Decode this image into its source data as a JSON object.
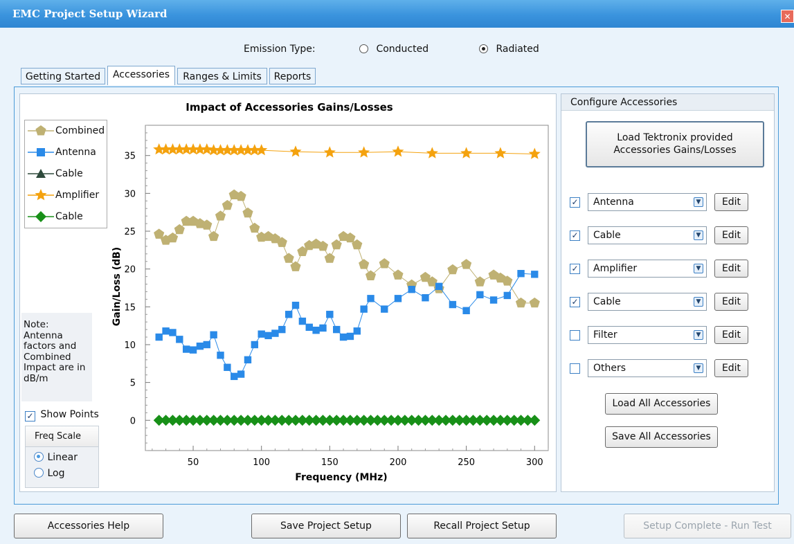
{
  "window": {
    "title": "EMC Project Setup Wizard",
    "close_icon": "close-icon"
  },
  "emission": {
    "label": "Emission Type:",
    "options": [
      {
        "label": "Conducted",
        "selected": false
      },
      {
        "label": "Radiated",
        "selected": true
      }
    ]
  },
  "tabs": [
    {
      "label": "Getting Started",
      "active": false
    },
    {
      "label": "Accessories",
      "active": true
    },
    {
      "label": "Ranges & Limits",
      "active": false
    },
    {
      "label": "Reports",
      "active": false
    }
  ],
  "chart_panel": {
    "note": "Note:\nAntenna\nfactors and\nCombined\nImpact are in\ndB/m",
    "show_points": {
      "label": "Show Points",
      "checked": true
    },
    "freq_scale": {
      "title": "Freq Scale",
      "options": [
        {
          "label": "Linear",
          "selected": true
        },
        {
          "label": "Log",
          "selected": false
        }
      ]
    }
  },
  "chart_data": {
    "type": "line",
    "title": "Impact of Accessories Gains/Losses",
    "xlabel": "Frequency (MHz)",
    "ylabel": "Gain/Loss (dB)",
    "xlim": [
      15,
      310
    ],
    "ylim": [
      -4,
      39
    ],
    "xticks": [
      50,
      100,
      150,
      200,
      250,
      300
    ],
    "yticks": [
      0,
      5,
      10,
      15,
      20,
      25,
      30,
      35
    ],
    "legend_position": "top-left",
    "series": [
      {
        "name": "Combined",
        "color": "#bfb173",
        "marker": "pentagon",
        "x": [
          25,
          30,
          35,
          40,
          45,
          50,
          55,
          60,
          65,
          70,
          75,
          80,
          85,
          90,
          95,
          100,
          105,
          110,
          115,
          120,
          125,
          130,
          135,
          140,
          145,
          150,
          155,
          160,
          165,
          170,
          175,
          180,
          190,
          200,
          210,
          220,
          225,
          230,
          240,
          250,
          260,
          270,
          275,
          280,
          290,
          300
        ],
        "y": [
          24.6,
          23.8,
          24.1,
          25.2,
          26.3,
          26.3,
          26.0,
          25.8,
          24.3,
          27.0,
          28.4,
          29.8,
          29.6,
          27.4,
          25.4,
          24.2,
          24.3,
          24.0,
          23.5,
          21.4,
          20.3,
          22.3,
          23.1,
          23.3,
          23.0,
          21.4,
          23.2,
          24.3,
          24.1,
          23.2,
          20.6,
          19.1,
          20.7,
          19.2,
          17.9,
          18.9,
          18.3,
          17.4,
          19.9,
          20.6,
          18.3,
          19.2,
          18.8,
          18.4,
          15.5,
          15.5
        ]
      },
      {
        "name": "Antenna",
        "color": "#2a8ae8",
        "marker": "square",
        "x": [
          25,
          30,
          35,
          40,
          45,
          50,
          55,
          60,
          65,
          70,
          75,
          80,
          85,
          90,
          95,
          100,
          105,
          110,
          115,
          120,
          125,
          130,
          135,
          140,
          145,
          150,
          155,
          160,
          165,
          170,
          175,
          180,
          190,
          200,
          210,
          220,
          230,
          240,
          250,
          260,
          270,
          280,
          290,
          300
        ],
        "y": [
          11.0,
          11.8,
          11.6,
          10.7,
          9.4,
          9.3,
          9.8,
          10.0,
          11.3,
          8.6,
          7.0,
          5.8,
          6.1,
          8.0,
          10.0,
          11.4,
          11.2,
          11.5,
          12.0,
          14.0,
          15.2,
          13.1,
          12.3,
          11.9,
          12.2,
          14.0,
          12.0,
          11.0,
          11.1,
          11.8,
          14.7,
          16.1,
          14.7,
          16.1,
          17.3,
          16.2,
          17.7,
          15.3,
          14.5,
          16.6,
          15.9,
          16.5,
          19.4,
          19.3
        ]
      },
      {
        "name": "Cable",
        "color": "#2e4a3c",
        "marker": "triangle",
        "x": [],
        "y": []
      },
      {
        "name": "Amplifier",
        "color": "#f4a20e",
        "marker": "star",
        "x": [
          25,
          30,
          35,
          40,
          45,
          50,
          55,
          60,
          65,
          70,
          75,
          80,
          85,
          90,
          95,
          100,
          125,
          150,
          175,
          200,
          225,
          250,
          275,
          300
        ],
        "y": [
          35.8,
          35.8,
          35.8,
          35.8,
          35.8,
          35.8,
          35.8,
          35.8,
          35.7,
          35.7,
          35.7,
          35.7,
          35.7,
          35.7,
          35.7,
          35.7,
          35.5,
          35.4,
          35.4,
          35.5,
          35.3,
          35.3,
          35.3,
          35.2
        ]
      },
      {
        "name": "Cable",
        "color": "#189018",
        "marker": "diamond",
        "x": [
          25,
          30,
          35,
          40,
          45,
          50,
          55,
          60,
          65,
          70,
          75,
          80,
          85,
          90,
          95,
          100,
          105,
          110,
          115,
          120,
          125,
          130,
          135,
          140,
          145,
          150,
          155,
          160,
          165,
          170,
          175,
          180,
          185,
          190,
          195,
          200,
          205,
          210,
          215,
          220,
          225,
          230,
          235,
          240,
          245,
          250,
          255,
          260,
          265,
          270,
          275,
          280,
          285,
          290,
          295,
          300
        ],
        "y": [
          0,
          0,
          0,
          0,
          0,
          0,
          0,
          0,
          0,
          0,
          0,
          0,
          0,
          0,
          0,
          0,
          0,
          0,
          0,
          0,
          0,
          0,
          0,
          0,
          0,
          0,
          0,
          0,
          0,
          0,
          0,
          0,
          0,
          0,
          0,
          0,
          0,
          0,
          0,
          0,
          0,
          0,
          0,
          0,
          0,
          0,
          0,
          0,
          0,
          0,
          0,
          0,
          0,
          0,
          0,
          0
        ]
      }
    ]
  },
  "configure": {
    "title": "Configure Accessories",
    "load_provided": "Load Tektronix provided\nAccessories Gains/Losses",
    "rows": [
      {
        "name": "Antenna",
        "checked": true,
        "edit": "Edit"
      },
      {
        "name": "Cable",
        "checked": true,
        "edit": "Edit"
      },
      {
        "name": "Amplifier",
        "checked": true,
        "edit": "Edit"
      },
      {
        "name": "Cable",
        "checked": true,
        "edit": "Edit"
      },
      {
        "name": "Filter",
        "checked": false,
        "edit": "Edit"
      },
      {
        "name": "Others",
        "checked": false,
        "edit": "Edit"
      }
    ],
    "load_all": "Load All Accessories",
    "save_all": "Save All Accessories"
  },
  "footer": {
    "help": "Accessories Help",
    "save": "Save Project Setup",
    "recall": "Recall Project Setup",
    "run": "Setup Complete - Run Test"
  }
}
